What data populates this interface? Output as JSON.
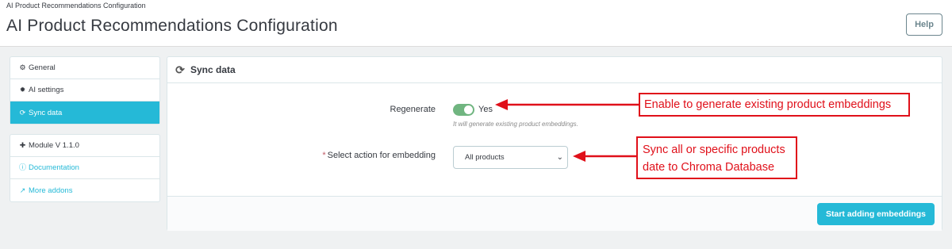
{
  "header": {
    "breadcrumb": "AI Product Recommendations Configuration",
    "title": "AI Product Recommendations Configuration",
    "help_label": "Help"
  },
  "sidebar": {
    "nav": [
      {
        "label": "General",
        "icon": "cogs-icon"
      },
      {
        "label": "AI settings",
        "icon": "gear-icon"
      },
      {
        "label": "Sync data",
        "icon": "refresh-icon",
        "active": true
      }
    ],
    "info": [
      {
        "label": "Module V 1.1.0",
        "icon": "puzzle-icon"
      },
      {
        "label": "Documentation",
        "icon": "info-circle-icon"
      },
      {
        "label": "More addons",
        "icon": "external-link-icon"
      }
    ]
  },
  "panel": {
    "title": "Sync data",
    "regenerate": {
      "label": "Regenerate",
      "value_label": "Yes",
      "enabled": true,
      "hint": "It will generate existing product embeddings."
    },
    "action": {
      "required_mark": "*",
      "label": "Select action for embedding",
      "selected": "All products"
    },
    "submit_label": "Start adding embeddings"
  },
  "annotations": {
    "regenerate_note": "Enable to generate existing product embeddings",
    "action_note_line1": "Sync all or specific products",
    "action_note_line2": "date to Chroma Database"
  },
  "colors": {
    "accent": "#25b9d7",
    "switch_on": "#70b580",
    "annotation_red": "#e0101a"
  }
}
